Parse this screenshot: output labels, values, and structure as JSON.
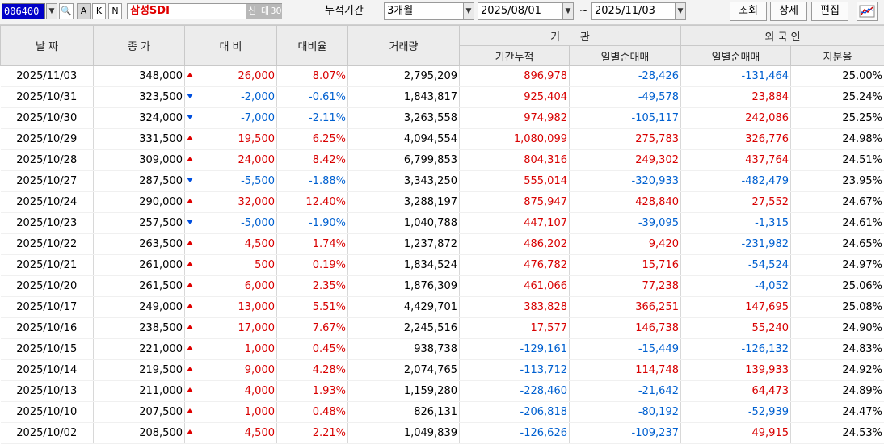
{
  "toolbar": {
    "code": "006400",
    "btn_search": "🔍",
    "btn_a": "A",
    "btn_k": "K",
    "btn_n": "N",
    "name": "삼성SDI",
    "tag1": "신",
    "tag2": "대",
    "tag3": "30",
    "period_label": "누적기간",
    "period_value": "3개월",
    "from_date": "2025/08/01",
    "tilde": "~",
    "to_date": "2025/11/03",
    "btn_query": "조회",
    "btn_detail": "상세",
    "btn_edit": "편집"
  },
  "headers": {
    "date": "날 짜",
    "close": "종 가",
    "change": "대 비",
    "rate": "대비율",
    "volume": "거래량",
    "inst": "기      관",
    "inst_cum": "기간누적",
    "inst_daily": "일별순매매",
    "foreign": "외 국 인",
    "foreign_daily": "일별순매매",
    "foreign_share": "지분율"
  },
  "rows": [
    {
      "date": "2025/11/03",
      "close": "348,000",
      "dir": "up",
      "change": "26,000",
      "rate": "8.07%",
      "volume": "2,795,209",
      "inst_cum": "896,978",
      "inst_daily": "-28,426",
      "foreign_daily": "-131,464",
      "share": "25.00%"
    },
    {
      "date": "2025/10/31",
      "close": "323,500",
      "dir": "down",
      "change": "-2,000",
      "rate": "-0.61%",
      "volume": "1,843,817",
      "inst_cum": "925,404",
      "inst_daily": "-49,578",
      "foreign_daily": "23,884",
      "share": "25.24%"
    },
    {
      "date": "2025/10/30",
      "close": "324,000",
      "dir": "down",
      "change": "-7,000",
      "rate": "-2.11%",
      "volume": "3,263,558",
      "inst_cum": "974,982",
      "inst_daily": "-105,117",
      "foreign_daily": "242,086",
      "share": "25.25%"
    },
    {
      "date": "2025/10/29",
      "close": "331,500",
      "dir": "up",
      "change": "19,500",
      "rate": "6.25%",
      "volume": "4,094,554",
      "inst_cum": "1,080,099",
      "inst_daily": "275,783",
      "foreign_daily": "326,776",
      "share": "24.98%"
    },
    {
      "date": "2025/10/28",
      "close": "309,000",
      "dir": "up",
      "change": "24,000",
      "rate": "8.42%",
      "volume": "6,799,853",
      "inst_cum": "804,316",
      "inst_daily": "249,302",
      "foreign_daily": "437,764",
      "share": "24.51%"
    },
    {
      "date": "2025/10/27",
      "close": "287,500",
      "dir": "down",
      "change": "-5,500",
      "rate": "-1.88%",
      "volume": "3,343,250",
      "inst_cum": "555,014",
      "inst_daily": "-320,933",
      "foreign_daily": "-482,479",
      "share": "23.95%"
    },
    {
      "date": "2025/10/24",
      "close": "290,000",
      "dir": "up",
      "change": "32,000",
      "rate": "12.40%",
      "volume": "3,288,197",
      "inst_cum": "875,947",
      "inst_daily": "428,840",
      "foreign_daily": "27,552",
      "share": "24.67%"
    },
    {
      "date": "2025/10/23",
      "close": "257,500",
      "dir": "down",
      "change": "-5,000",
      "rate": "-1.90%",
      "volume": "1,040,788",
      "inst_cum": "447,107",
      "inst_daily": "-39,095",
      "foreign_daily": "-1,315",
      "share": "24.61%"
    },
    {
      "date": "2025/10/22",
      "close": "263,500",
      "dir": "up",
      "change": "4,500",
      "rate": "1.74%",
      "volume": "1,237,872",
      "inst_cum": "486,202",
      "inst_daily": "9,420",
      "foreign_daily": "-231,982",
      "share": "24.65%"
    },
    {
      "date": "2025/10/21",
      "close": "261,000",
      "dir": "up",
      "change": "500",
      "rate": "0.19%",
      "volume": "1,834,524",
      "inst_cum": "476,782",
      "inst_daily": "15,716",
      "foreign_daily": "-54,524",
      "share": "24.97%"
    },
    {
      "date": "2025/10/20",
      "close": "261,500",
      "dir": "up",
      "change": "6,000",
      "rate": "2.35%",
      "volume": "1,876,309",
      "inst_cum": "461,066",
      "inst_daily": "77,238",
      "foreign_daily": "-4,052",
      "share": "25.06%"
    },
    {
      "date": "2025/10/17",
      "close": "249,000",
      "dir": "up",
      "change": "13,000",
      "rate": "5.51%",
      "volume": "4,429,701",
      "inst_cum": "383,828",
      "inst_daily": "366,251",
      "foreign_daily": "147,695",
      "share": "25.08%"
    },
    {
      "date": "2025/10/16",
      "close": "238,500",
      "dir": "up",
      "change": "17,000",
      "rate": "7.67%",
      "volume": "2,245,516",
      "inst_cum": "17,577",
      "inst_daily": "146,738",
      "foreign_daily": "55,240",
      "share": "24.90%"
    },
    {
      "date": "2025/10/15",
      "close": "221,000",
      "dir": "up",
      "change": "1,000",
      "rate": "0.45%",
      "volume": "938,738",
      "inst_cum": "-129,161",
      "inst_daily": "-15,449",
      "foreign_daily": "-126,132",
      "share": "24.83%"
    },
    {
      "date": "2025/10/14",
      "close": "219,500",
      "dir": "up",
      "change": "9,000",
      "rate": "4.28%",
      "volume": "2,074,765",
      "inst_cum": "-113,712",
      "inst_daily": "114,748",
      "foreign_daily": "139,933",
      "share": "24.92%"
    },
    {
      "date": "2025/10/13",
      "close": "211,000",
      "dir": "up",
      "change": "4,000",
      "rate": "1.93%",
      "volume": "1,159,280",
      "inst_cum": "-228,460",
      "inst_daily": "-21,642",
      "foreign_daily": "64,473",
      "share": "24.89%"
    },
    {
      "date": "2025/10/10",
      "close": "207,500",
      "dir": "up",
      "change": "1,000",
      "rate": "0.48%",
      "volume": "826,131",
      "inst_cum": "-206,818",
      "inst_daily": "-80,192",
      "foreign_daily": "-52,939",
      "share": "24.47%"
    },
    {
      "date": "2025/10/02",
      "close": "208,500",
      "dir": "up",
      "change": "4,500",
      "rate": "2.21%",
      "volume": "1,049,839",
      "inst_cum": "-126,626",
      "inst_daily": "-109,237",
      "foreign_daily": "49,915",
      "share": "24.53%"
    }
  ],
  "colors": {
    "up": "#d80000",
    "down": "#0060d0"
  }
}
